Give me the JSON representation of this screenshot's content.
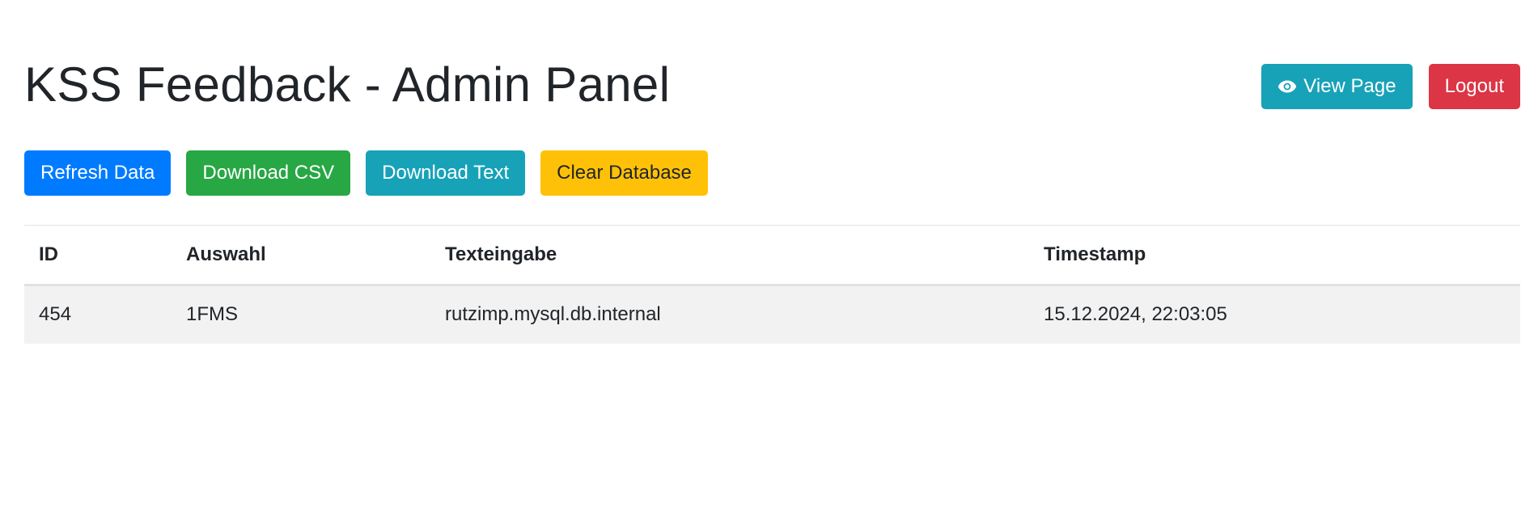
{
  "header": {
    "title": "KSS Feedback - Admin Panel",
    "view_page_label": "View Page",
    "view_page_icon": "eye-icon",
    "logout_label": "Logout"
  },
  "toolbar": {
    "refresh_label": "Refresh Data",
    "download_csv_label": "Download CSV",
    "download_text_label": "Download Text",
    "clear_db_label": "Clear Database"
  },
  "table": {
    "columns": [
      "ID",
      "Auswahl",
      "Texteingabe",
      "Timestamp"
    ],
    "rows": [
      [
        "454",
        "1FMS",
        "rutzimp.mysql.db.internal",
        "15.12.2024, 22:03:05"
      ]
    ]
  },
  "colors": {
    "primary": "#007bff",
    "success": "#28a745",
    "info": "#17a2b8",
    "warning": "#ffc107",
    "danger": "#dc3545",
    "row_stripe": "#f2f2f2"
  }
}
